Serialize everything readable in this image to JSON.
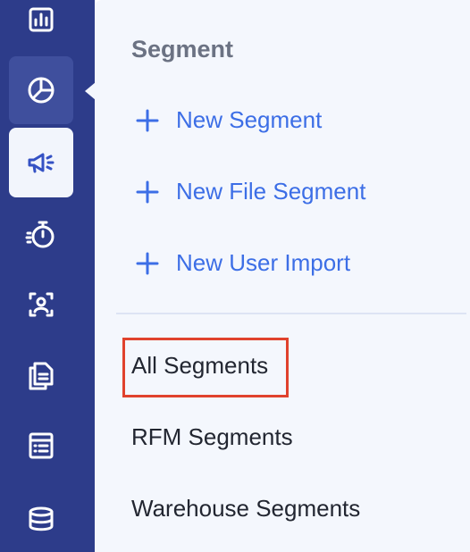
{
  "sidebar": {
    "items": [
      {
        "name": "reports",
        "icon": "bar-chart-icon",
        "state": "normal"
      },
      {
        "name": "analytics",
        "icon": "pie-chart-icon",
        "state": "hovered"
      },
      {
        "name": "campaigns",
        "icon": "megaphone-icon",
        "state": "active"
      },
      {
        "name": "timer",
        "icon": "stopwatch-icon",
        "state": "normal"
      },
      {
        "name": "users",
        "icon": "user-frame-icon",
        "state": "normal"
      },
      {
        "name": "documents",
        "icon": "documents-icon",
        "state": "normal"
      },
      {
        "name": "catalog",
        "icon": "table-list-icon",
        "state": "normal"
      },
      {
        "name": "data",
        "icon": "database-icon",
        "state": "normal"
      }
    ]
  },
  "panel": {
    "title": "Segment",
    "actions": [
      {
        "label": "New Segment",
        "icon": "plus-icon"
      },
      {
        "label": "New File Segment",
        "icon": "plus-icon"
      },
      {
        "label": "New User Import",
        "icon": "plus-icon"
      }
    ],
    "links": [
      {
        "label": "All Segments",
        "highlighted": true
      },
      {
        "label": "RFM Segments"
      },
      {
        "label": "Warehouse Segments"
      }
    ]
  },
  "colors": {
    "sidebar": "#2d3c8a",
    "panel": "#f4f7fd",
    "accent": "#3c6ee6",
    "highlight_border": "#e0422d"
  }
}
